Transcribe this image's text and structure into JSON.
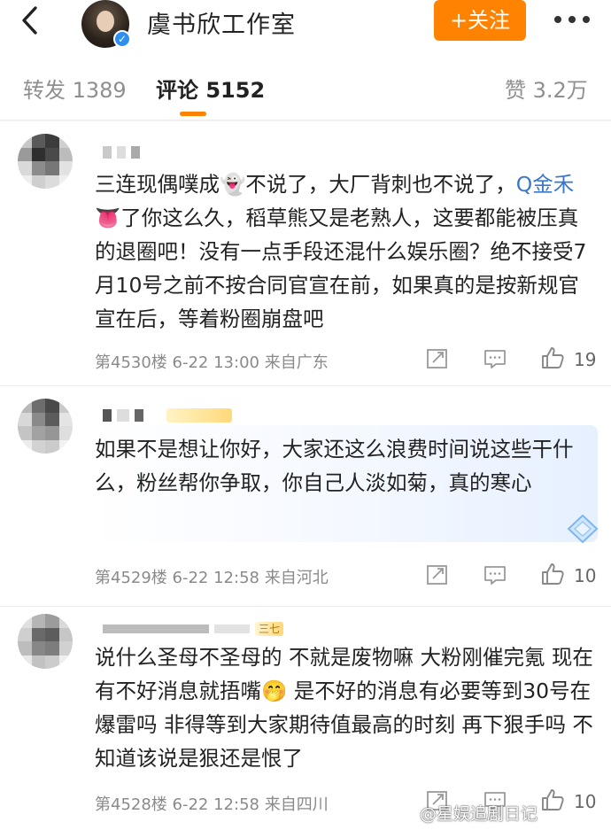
{
  "header": {
    "back_icon": "chevron-left-icon",
    "studio_name": "虞书欣工作室",
    "follow_label": "+关注",
    "more_icon": "ellipsis-icon",
    "verified_icon": "verified-badge-icon"
  },
  "tabs": [
    {
      "label": "转发 1389",
      "active": false
    },
    {
      "label": "评论 5152",
      "active": true
    },
    {
      "label": "赞 3.2万",
      "active": false
    }
  ],
  "colors": {
    "accent": "#ff8200",
    "topic_link": "#3a78c9",
    "meta": "#8a8a8a"
  },
  "comments": [
    {
      "text_before_topic": "三连现偶噗成👻不说了，大厂背刺也不说了，",
      "topic": "Q金禾",
      "text_after_topic": "👅了你这么久，稻草熊又是老熟人，这要都能被压真的退圈吧！没有一点手段还混什么娱乐圈？绝不接受7月10号之前不按合同官宣在前，如果真的是按新规官宣在后，等着粉圈崩盘吧",
      "meta": "第4530楼  6-22 13:00  来自广东",
      "likes": "19"
    },
    {
      "text": "如果不是想让你好，大家还这么浪费时间说这些干什么，粉丝帮你争取，你自己人淡如菊，真的寒心",
      "meta": "第4529楼  6-22 12:58  来自河北",
      "likes": "10"
    },
    {
      "text": "说什么圣母不圣母的 不就是废物嘛 大粉刚催完氪 现在有不好消息就捂嘴🤭 是不好的消息有必要等到30号在爆雷吗 非得等到大家期待值最高的时刻 再下狠手吗 不知道该说是狠还是恨了",
      "meta": "第4528楼  6-22 12:58  来自四川",
      "likes": "10"
    }
  ],
  "name_badge_text": "三七",
  "icons": {
    "share": "share-icon",
    "reply": "comment-icon",
    "like": "thumbs-up-icon"
  },
  "watermark": "@星娱追剧日记"
}
